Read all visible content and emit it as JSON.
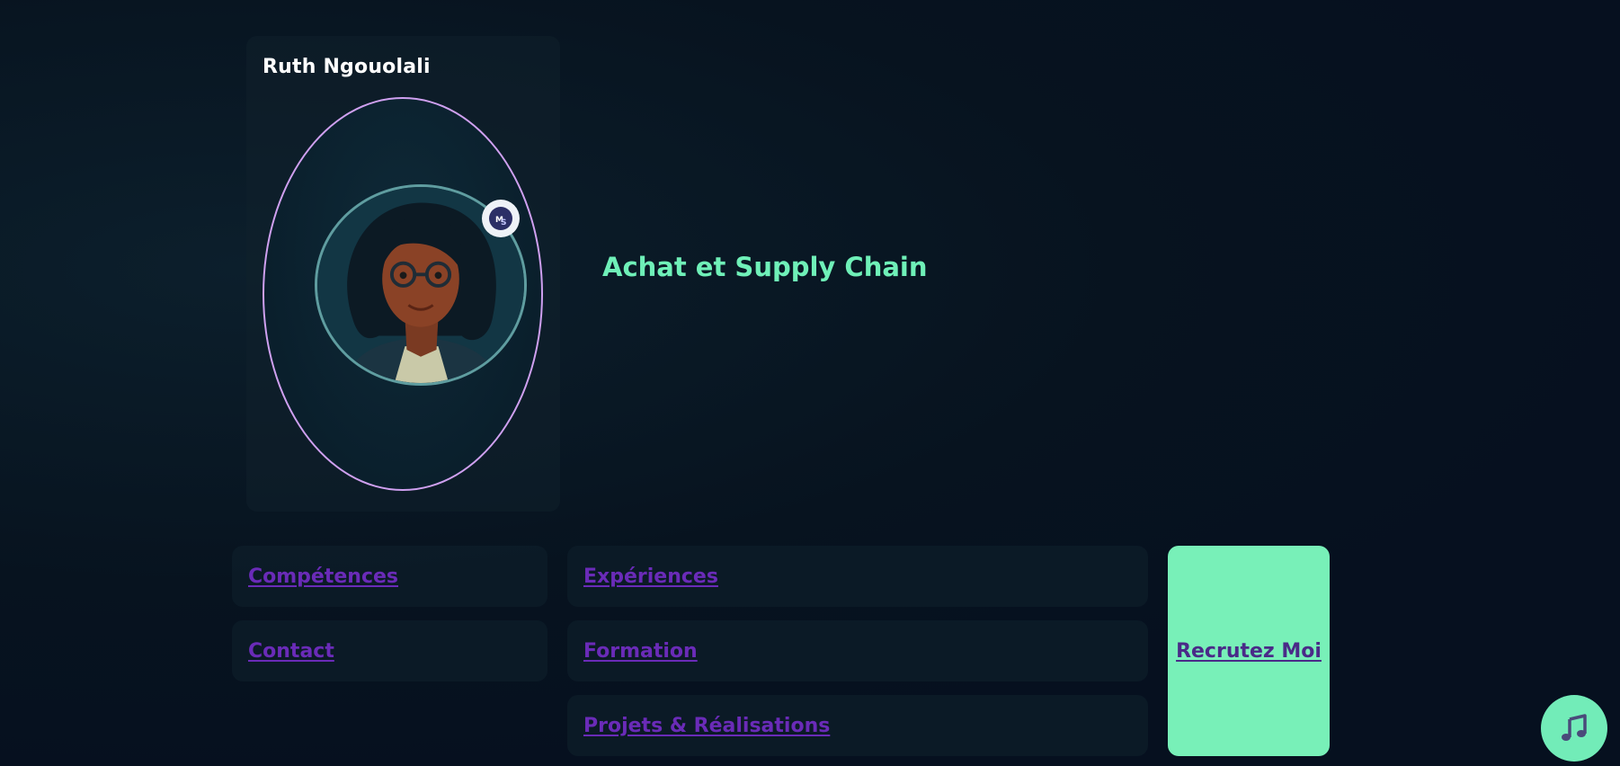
{
  "profile": {
    "name": "Ruth Ngouolali",
    "badge_icon": "avatar-badge-icon",
    "ellipse_border_color": "#cfa0f0",
    "ring_color": "#5f9da0"
  },
  "headline": "Achat et Supply Chain",
  "nav": {
    "competences": "Compétences",
    "contact": "Contact",
    "experiences": "Expériences",
    "formation": "Formation",
    "projets": "Projets & Réalisations",
    "recrutez": "Recrutez Moi"
  },
  "music_button": {
    "icon": "music-note-icon"
  },
  "colors": {
    "background": "#06101f",
    "accent": "#6ff0b8",
    "link": "#6a2bb8",
    "cta_bg": "#78f0b8"
  }
}
